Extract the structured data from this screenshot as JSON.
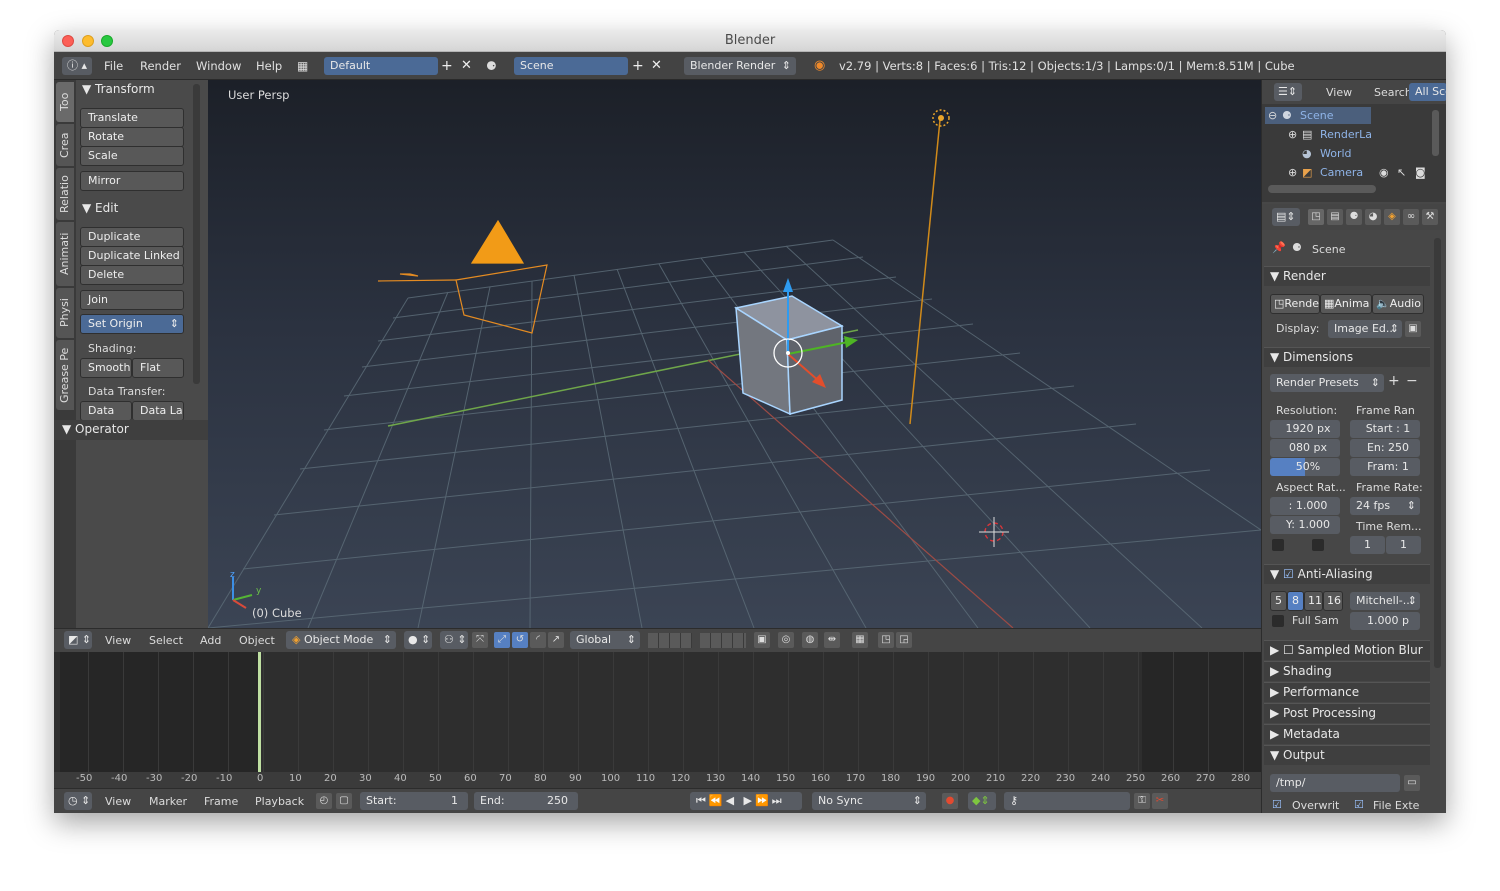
{
  "window": {
    "title": "Blender"
  },
  "infobar": {
    "menus": [
      "File",
      "Render",
      "Window",
      "Help"
    ],
    "screen_layout": "Default",
    "scene": "Scene",
    "engine": "Blender Render",
    "stats": "v2.79 | Verts:8 | Faces:6 | Tris:12 | Objects:1/3 | Lamps:0/1 | Mem:8.51M | Cube"
  },
  "toolshelf": {
    "tabs": [
      "Too",
      "Crea",
      "Relatio",
      "Animati",
      "Physi",
      "Grease Pe"
    ],
    "transform": {
      "title": "Transform",
      "buttons": [
        "Translate",
        "Rotate",
        "Scale",
        "Mirror"
      ]
    },
    "edit": {
      "title": "Edit",
      "buttons": [
        "Duplicate",
        "Duplicate Linked",
        "Delete",
        "Join"
      ],
      "set_origin": "Set Origin",
      "shading_label": "Shading:",
      "smooth": "Smooth",
      "flat": "Flat",
      "data_transfer_label": "Data Transfer:",
      "data": "Data",
      "data_la": "Data La"
    },
    "operator": {
      "title": "Operator"
    }
  },
  "viewport": {
    "view_name": "User Persp",
    "object_label": "(0) Cube",
    "axes": {
      "z": "z",
      "y": "y"
    }
  },
  "view3d_header": {
    "menus": [
      "View",
      "Select",
      "Add",
      "Object"
    ],
    "mode": "Object Mode",
    "orientation": "Global"
  },
  "timeline": {
    "ruler": [
      "-50",
      "-40",
      "-30",
      "-20",
      "-10",
      "0",
      "10",
      "20",
      "30",
      "40",
      "50",
      "60",
      "70",
      "80",
      "90",
      "100",
      "110",
      "120",
      "130",
      "140",
      "150",
      "160",
      "170",
      "180",
      "190",
      "200",
      "210",
      "220",
      "230",
      "240",
      "250",
      "260",
      "270",
      "280"
    ],
    "menus": [
      "View",
      "Marker",
      "Frame",
      "Playback"
    ],
    "start_label": "Start:",
    "start_value": "1",
    "end_label": "End:",
    "end_value": "250",
    "current_frame": "0",
    "sync": "No Sync"
  },
  "outliner": {
    "menus": [
      "View",
      "Search"
    ],
    "filter": "All Sce",
    "items": [
      "Scene",
      "RenderLa",
      "World",
      "Camera"
    ]
  },
  "properties": {
    "context": "Scene",
    "render": {
      "title": "Render",
      "buttons": [
        "Rende",
        "Anima",
        "Audio"
      ],
      "display_label": "Display:",
      "display_value": "Image Ed..."
    },
    "dimensions": {
      "title": "Dimensions",
      "presets": "Render Presets",
      "resolution_label": "Resolution:",
      "res_x": "1920 px",
      "res_y": "080 px",
      "res_pct": "50%",
      "frame_range_label": "Frame Ran",
      "start": "Start : 1",
      "end": "En: 250",
      "frame_step": "Fram: 1",
      "aspect_label": "Aspect Rat...",
      "aspect_x": ": 1.000",
      "aspect_y": "Y: 1.000",
      "frame_rate_label": "Frame Rate:",
      "frame_rate": "24 fps",
      "time_remap_label": "Time Rem...",
      "remap_old": "1",
      "remap_new": "1"
    },
    "anti_aliasing": {
      "title": "Anti-Aliasing",
      "samples": [
        "5",
        "8",
        "11",
        "16"
      ],
      "filter": "Mitchell-...",
      "full_sample": "Full Sam",
      "filter_size": "1.000 p"
    },
    "collapsed": [
      "Sampled Motion Blur",
      "Shading",
      "Performance",
      "Post Processing",
      "Metadata"
    ],
    "output": {
      "title": "Output",
      "path": "/tmp/",
      "overwrite": "Overwrit",
      "file_ext": "File Exte"
    }
  }
}
